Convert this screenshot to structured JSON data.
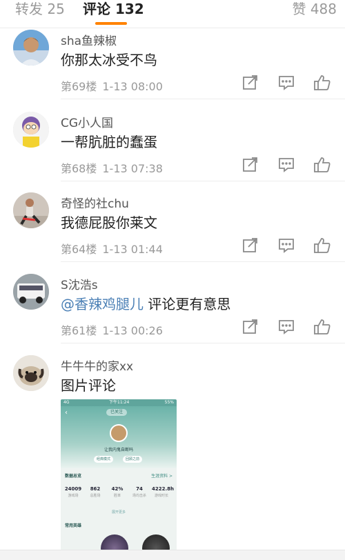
{
  "tabs": {
    "forward_label": "转发 25",
    "comments_label": "评论 132",
    "likes_label": "赞 488",
    "accent_color": "#ff8200"
  },
  "comments": [
    {
      "username": "sha鱼辣椒",
      "text": "你那太冰受不鸟",
      "floor": "第69楼",
      "time": "1-13 08:00"
    },
    {
      "username": "CG小人国",
      "text": "一帮肮脏的蠢蛋",
      "floor": "第68楼",
      "time": "1-13 07:38"
    },
    {
      "username": "奇怪的社chu",
      "text": "我德屁股你莱文",
      "floor": "第64楼",
      "time": "1-13 01:44"
    },
    {
      "username": "S沈浩s",
      "mention": "@香辣鸡腿儿",
      "text": " 评论更有意思",
      "floor": "第61楼",
      "time": "1-13 00:26"
    },
    {
      "username": "牛牛牛的家xx",
      "text": "图片评论"
    }
  ],
  "icons": {
    "share": "share-icon",
    "reply": "comment-icon",
    "like": "thumbs-up-icon"
  },
  "image_comment": {
    "status_left": "4G",
    "status_time": "下午11:24",
    "status_right": "55%",
    "pill": "已关注",
    "name": "让我内鬼自断吗",
    "chip_left": "经典模式",
    "chip_right": "回顾之前",
    "section_title": "数据总览",
    "section_link": "生涯资料 >",
    "stats": [
      {
        "value": "24009",
        "label": "游戏场"
      },
      {
        "value": "862",
        "label": "总胜场"
      },
      {
        "value": "42%",
        "label": "胜率"
      },
      {
        "value": "74",
        "label": "场均击杀"
      },
      {
        "value": "4222.8h",
        "label": "游戏时长"
      }
    ],
    "more": "展开更多",
    "section2_title": "常用英雄"
  }
}
